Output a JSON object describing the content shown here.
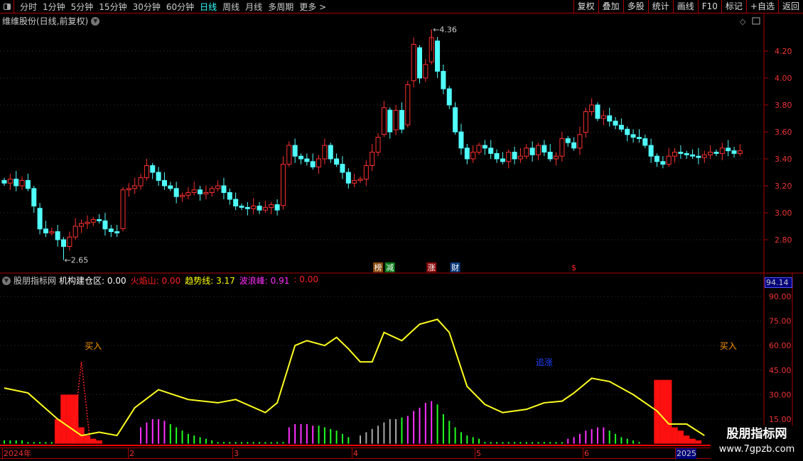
{
  "toolbar": {
    "periods": [
      "分时",
      "1分钟",
      "5分钟",
      "15分钟",
      "30分钟",
      "60分钟",
      "日线",
      "周线",
      "月线",
      "多周期",
      "更多 >"
    ],
    "active": "日线",
    "buttons": [
      "复权",
      "叠加",
      "多股",
      "统计",
      "画线",
      "F10",
      "标记",
      "+自选",
      "返回"
    ]
  },
  "main": {
    "title": "维维股份(日线,前复权)",
    "high_label": "4.36",
    "low_label": "2.65",
    "price_ticks": [
      "4.20",
      "4.00",
      "3.80",
      "3.60",
      "3.40",
      "3.20",
      "3.00",
      "2.80"
    ],
    "tags": [
      {
        "text": "榜",
        "color": "#8a4a10",
        "i": 63
      },
      {
        "text": "减",
        "color": "#0a7a1a",
        "i": 65
      },
      {
        "text": "涨",
        "color": "#8a0a0a",
        "i": 72
      },
      {
        "text": "财",
        "color": "#0a3a7a",
        "i": 76
      },
      {
        "text": "$",
        "color": "#000",
        "i": 96
      }
    ]
  },
  "indicator": {
    "name": "股朋指标网",
    "fields": [
      {
        "label": "机构建仓区:",
        "value": "0.00",
        "color": "#ffffff"
      },
      {
        "label": "火焰山:",
        "value": "0.00",
        "color": "#ff2020"
      },
      {
        "label": "趋势线:",
        "value": "3.17",
        "color": "#ffff00"
      },
      {
        "label": "波浪峰:",
        "value": "0.91",
        "color": "#ff30ff"
      },
      {
        "label": ":",
        "value": "0.00",
        "color": "#ff2020"
      }
    ],
    "current_value": "94.14",
    "ticks": [
      "90.00",
      "75.00",
      "60.00",
      "45.00",
      "30.00",
      "15.00"
    ],
    "annotations": [
      {
        "text": "买入",
        "i": 15,
        "v": 58,
        "color": "#ff9900"
      },
      {
        "text": "追涨",
        "i": 91,
        "v": 48,
        "color": "#2040ff"
      },
      {
        "text": "买入",
        "i": 122,
        "v": 58,
        "color": "#ff9900"
      }
    ]
  },
  "time_axis": {
    "labels": [
      "2024年",
      "2",
      "3",
      "4",
      "5",
      "6",
      "2025/"
    ]
  },
  "watermark": {
    "cn": "股朋指标网",
    "url": "www.7gpzb.com"
  },
  "chart_data": [
    {
      "type": "candlestick",
      "ylim": [
        2.6,
        4.4
      ],
      "closes": [
        3.22,
        3.25,
        3.2,
        3.24,
        3.18,
        3.05,
        2.88,
        2.85,
        2.86,
        2.8,
        2.75,
        2.82,
        2.9,
        2.92,
        2.93,
        2.95,
        2.94,
        2.88,
        2.86,
        2.85,
        3.17,
        3.18,
        3.2,
        3.26,
        3.35,
        3.3,
        3.24,
        3.2,
        3.18,
        3.12,
        3.13,
        3.15,
        3.17,
        3.14,
        3.15,
        3.18,
        3.2,
        3.15,
        3.1,
        3.05,
        3.04,
        3.03,
        3.05,
        3.02,
        3.04,
        3.06,
        3.02,
        3.36,
        3.5,
        3.42,
        3.4,
        3.38,
        3.34,
        3.4,
        3.5,
        3.4,
        3.36,
        3.3,
        3.22,
        3.24,
        3.25,
        3.35,
        3.45,
        3.56,
        3.78,
        3.6,
        3.76,
        3.62,
        3.95,
        4.25,
        4.0,
        4.1,
        4.3,
        4.05,
        3.92,
        3.8,
        3.6,
        3.48,
        3.4,
        3.45,
        3.5,
        3.48,
        3.44,
        3.4,
        3.38,
        3.45,
        3.4,
        3.42,
        3.48,
        3.43,
        3.5,
        3.45,
        3.4,
        3.42,
        3.55,
        3.52,
        3.48,
        3.58,
        3.75,
        3.8,
        3.7,
        3.72,
        3.68,
        3.65,
        3.62,
        3.58,
        3.56,
        3.55,
        3.5,
        3.42,
        3.38,
        3.36,
        3.42,
        3.45,
        3.44,
        3.43,
        3.42,
        3.41,
        3.43,
        3.45,
        3.44,
        3.48,
        3.46,
        3.44,
        3.46
      ],
      "high": 4.36,
      "low": 2.65
    },
    {
      "type": "line",
      "name": "趋势线",
      "ylim": [
        0,
        100
      ],
      "x": [
        0,
        4,
        9,
        13,
        16,
        19,
        22,
        26,
        31,
        36,
        39,
        44,
        46,
        49,
        51,
        54,
        56,
        58,
        60,
        62,
        64,
        67,
        70,
        73,
        75,
        78,
        81,
        84,
        88,
        91,
        94,
        96,
        99,
        102,
        106,
        110,
        112,
        115,
        118
      ],
      "y": [
        34,
        31,
        15,
        5,
        7,
        5,
        22,
        33,
        27,
        25,
        27,
        19,
        25,
        60,
        63,
        60,
        65,
        58,
        50,
        50,
        68,
        63,
        73,
        76,
        68,
        35,
        24,
        19,
        21,
        25,
        26,
        31,
        40,
        38,
        30,
        20,
        12,
        12,
        5
      ]
    },
    {
      "type": "bar",
      "name": "histogram",
      "segments": [
        {
          "from": 0,
          "color": "#20ff20",
          "values": [
            2,
            2,
            2,
            2,
            1,
            1,
            1,
            1,
            1
          ]
        },
        {
          "from": 23,
          "color": "#ff30ff",
          "values": [
            10,
            13,
            15,
            15,
            14
          ]
        },
        {
          "from": 28,
          "color": "#20ff20",
          "values": [
            12,
            10,
            8,
            6,
            5,
            4,
            3,
            2
          ]
        },
        {
          "from": 36,
          "color": "#20ff20",
          "values": [
            1,
            1,
            1,
            1,
            1,
            1,
            1,
            1,
            1,
            1,
            1,
            1
          ]
        },
        {
          "from": 48,
          "color": "#ff30ff",
          "values": [
            10,
            12,
            12,
            12,
            11
          ]
        },
        {
          "from": 53,
          "color": "#20ff20",
          "values": [
            11,
            10,
            9,
            8,
            6,
            4
          ]
        },
        {
          "from": 60,
          "color": "#aaaaaa",
          "values": [
            5,
            7,
            9,
            11,
            13,
            15,
            15
          ]
        },
        {
          "from": 67,
          "color": "#20ff20",
          "values": [
            16
          ]
        },
        {
          "from": 68,
          "color": "#ff30ff",
          "values": [
            17,
            20,
            22,
            25,
            26
          ]
        },
        {
          "from": 73,
          "color": "#20ff20",
          "values": [
            24,
            18,
            14,
            10,
            7,
            5,
            4,
            3
          ]
        },
        {
          "from": 81,
          "color": "#20ff20",
          "values": [
            1,
            1,
            1,
            1,
            1,
            1,
            1,
            1,
            1,
            1,
            1,
            1,
            1,
            1
          ]
        },
        {
          "from": 95,
          "color": "#ff30ff",
          "values": [
            3,
            4,
            6,
            8,
            9,
            10,
            10
          ]
        },
        {
          "from": 102,
          "color": "#20ff20",
          "values": [
            8,
            6,
            4,
            3,
            2,
            1
          ]
        }
      ],
      "red_blocks": [
        {
          "from": 9,
          "values": [
            15,
            30,
            30,
            30,
            10,
            5,
            3,
            2
          ]
        },
        {
          "from": 110,
          "values": [
            39,
            39,
            39,
            10,
            8,
            5,
            3,
            2
          ]
        }
      ],
      "spike": {
        "i": 13,
        "v": 50
      }
    }
  ]
}
